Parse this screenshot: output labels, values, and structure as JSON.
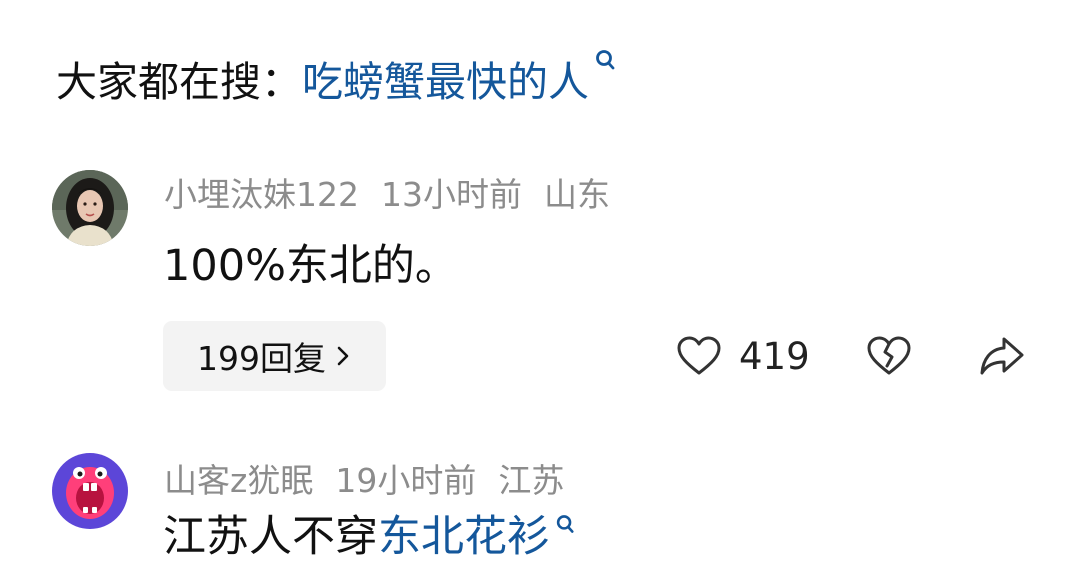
{
  "search": {
    "prefix": "大家都在搜：",
    "query": "吃螃蟹最快的人",
    "icon": "search-icon"
  },
  "comments": [
    {
      "username": "小埋汰妹122",
      "time": "13小时前",
      "location": "山东",
      "text": "100%东北的。",
      "reply_label": "199回复",
      "like_count": "419",
      "avatar": "user-photo-avatar"
    },
    {
      "username": "山客z犹眠",
      "time": "19小时前",
      "location": "江苏",
      "text": "江苏人不穿",
      "text_link": "东北花衫",
      "avatar": "cartoon-monster-avatar"
    }
  ],
  "colors": {
    "link": "#14579b",
    "meta": "#8c8c8c",
    "reply_bg": "#f3f3f3"
  }
}
